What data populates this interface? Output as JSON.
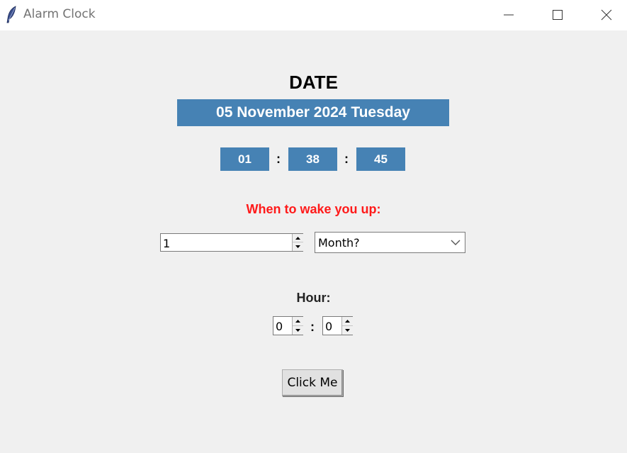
{
  "window": {
    "title": "Alarm Clock",
    "icon": "feather-icon"
  },
  "date_section": {
    "heading": "DATE",
    "date_text": "05 November 2024 Tuesday"
  },
  "clock": {
    "hours": "01",
    "minutes": "38",
    "seconds": "45",
    "separator": ":"
  },
  "alarm": {
    "prompt": "When to wake you up:",
    "day_value": "1",
    "month_selected": "Month?",
    "hour_label": "Hour:",
    "alarm_hour": "0",
    "alarm_minute": "0",
    "separator": ":"
  },
  "actions": {
    "submit_label": "Click Me"
  },
  "colors": {
    "accent": "#4682b4",
    "prompt": "#ff1a1a",
    "background": "#f0f0f0"
  }
}
